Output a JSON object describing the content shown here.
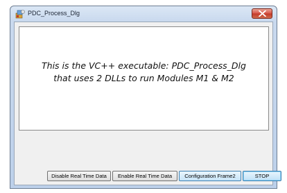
{
  "window": {
    "title": "PDC_Process_Dlg",
    "icon": "app-icon"
  },
  "info": {
    "line1": "This is the VC++ executable: PDC_Process_Dlg",
    "line2": "that uses 2 DLLs to run Modules M1 & M2"
  },
  "buttons": {
    "disable_rt": "Disable Real Time Data",
    "enable_rt": "Enable Real Time Data",
    "config": "Configuration Frame2",
    "stop": "STOP"
  },
  "colors": {
    "title_bar": "#c9d9ee",
    "close_button": "#c8402f",
    "dialog_bg": "#f0f0f0",
    "focus_border": "#3c7fb1"
  }
}
